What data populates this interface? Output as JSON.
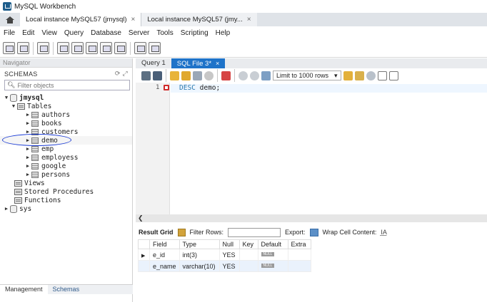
{
  "window": {
    "title": "MySQL Workbench"
  },
  "connection_tabs": [
    {
      "label": "Local instance MySQL57 (jmysql)",
      "close": "×"
    },
    {
      "label": "Local instance MySQL57 (jmy...",
      "close": "×"
    }
  ],
  "menu": [
    "File",
    "Edit",
    "View",
    "Query",
    "Database",
    "Server",
    "Tools",
    "Scripting",
    "Help"
  ],
  "navigator": {
    "header": "Navigator",
    "schemas_label": "SCHEMAS",
    "filter_placeholder": "Filter objects",
    "schema": "jmysql",
    "tables_folder": "Tables",
    "tables": [
      "authors",
      "books",
      "customers",
      "demo",
      "emp",
      "employess",
      "google",
      "persons"
    ],
    "views": "Views",
    "stored_procedures": "Stored Procedures",
    "functions": "Functions",
    "other_schema": "sys",
    "bottom_tabs": [
      "Management",
      "Schemas"
    ]
  },
  "editor": {
    "tabs": [
      {
        "label": "Query 1"
      },
      {
        "label": "SQL File 3*",
        "close": "×"
      }
    ],
    "limit": "Limit to 1000 rows",
    "line_number": "1",
    "code_keyword": "DESC",
    "code_rest": "demo;"
  },
  "result": {
    "grid_label": "Result Grid",
    "filter_label": "Filter Rows:",
    "export_label": "Export:",
    "wrap_label": "Wrap Cell Content:",
    "columns": [
      "Field",
      "Type",
      "Null",
      "Key",
      "Default",
      "Extra"
    ],
    "rows": [
      {
        "field": "e_id",
        "type": "int(3)",
        "null": "YES",
        "key": "",
        "default": "NULL",
        "extra": ""
      },
      {
        "field": "e_name",
        "type": "varchar(10)",
        "null": "YES",
        "key": "",
        "default": "NULL",
        "extra": ""
      }
    ]
  }
}
